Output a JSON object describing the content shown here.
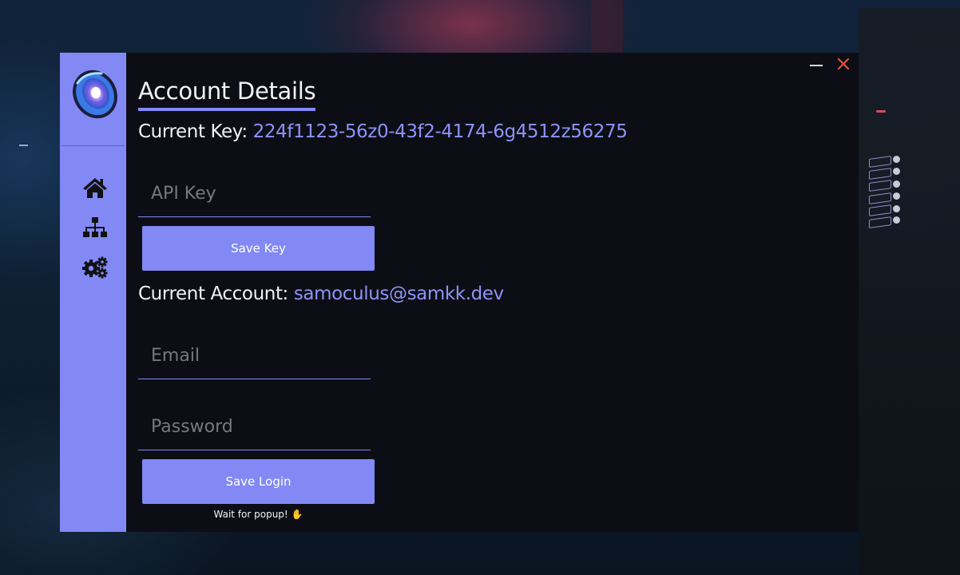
{
  "window": {
    "minimize_icon": "minimize-icon",
    "close_icon": "close-icon"
  },
  "sidebar": {
    "logo": "app-logo",
    "items": [
      {
        "id": "home",
        "icon": "home-icon"
      },
      {
        "id": "sitemap",
        "icon": "sitemap-icon"
      },
      {
        "id": "settings",
        "icon": "gears-icon"
      }
    ]
  },
  "main": {
    "title": "Account Details",
    "current_key_label": "Current Key:",
    "current_key_value": "224f1123-56z0-43f2-4174-6g4512z56275",
    "api_key_placeholder": "API Key",
    "save_key_label": "Save Key",
    "current_account_label": "Current Account:",
    "current_account_value": "samoculus@samkk.dev",
    "email_placeholder": "Email",
    "password_placeholder": "Password",
    "save_login_label": "Save Login",
    "hint": "Wait for popup! ✋"
  },
  "colors": {
    "accent": "#8289f5",
    "window_bg": "#0d0e15",
    "close": "#e0533d"
  }
}
